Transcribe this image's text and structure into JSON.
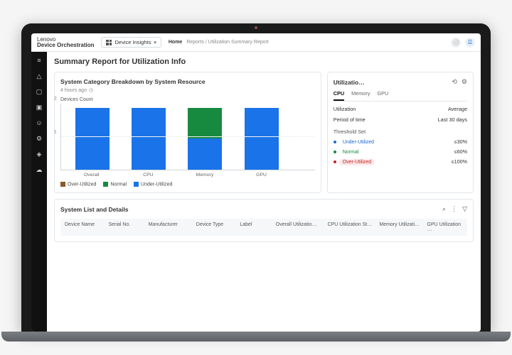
{
  "brand": {
    "line1": "Lenovo",
    "line2": "Device Orchestration"
  },
  "module_selector": {
    "label": "Device Insights"
  },
  "breadcrumbs": {
    "home": "Home",
    "path": "Reports / Utilization Summary Report"
  },
  "page_title": "Summary Report for Utilization Info",
  "chart_panel": {
    "title": "System Category Breakdown by System Resource",
    "timestamp": "4 hours ago",
    "y_axis_label": "Devices Count",
    "legend": {
      "over": "Over-Utilized",
      "normal": "Normal",
      "under": "Under-Utilized"
    }
  },
  "chart_data": {
    "type": "bar",
    "stacked": true,
    "categories": [
      "Overall",
      "CPU",
      "Memory",
      "GPU"
    ],
    "series": [
      {
        "name": "Over-Utilized",
        "color": "#8a5a2a",
        "values": [
          0,
          0,
          0,
          0
        ]
      },
      {
        "name": "Normal",
        "color": "#188a3f",
        "values": [
          0,
          0,
          1,
          0
        ]
      },
      {
        "name": "Under-Utilized",
        "color": "#1a73e8",
        "values": [
          2,
          2,
          1,
          2
        ]
      }
    ],
    "ylabel": "Devices Count",
    "ylim": [
      0,
      2
    ],
    "yticks": [
      1,
      2
    ]
  },
  "side_panel": {
    "title": "Utilizatio…",
    "tabs": [
      "CPU",
      "Memory",
      "GPU"
    ],
    "active_tab": "CPU",
    "rows": {
      "utilization_label": "Utilization",
      "utilization_value": "Average",
      "period_label": "Period of time",
      "period_value": "Last 30 days"
    },
    "threshold_title": "Threshold Set",
    "thresholds": [
      {
        "label": "Under-Utilized",
        "value": "≤30%",
        "kind": "under"
      },
      {
        "label": "Normal",
        "value": "≤60%",
        "kind": "normal"
      },
      {
        "label": "Over-Utilized",
        "value": "≤100%",
        "kind": "over"
      }
    ]
  },
  "list_panel": {
    "title": "System List and Details",
    "columns": [
      "Device Name",
      "Serial No.",
      "Manufacturer",
      "Device Type",
      "Label",
      "Overall Utilizatio…",
      "CPU Utilization St…",
      "Memory Utilizati…",
      "GPU Utilization …"
    ]
  },
  "sidebar_icons": [
    "menu",
    "alert",
    "monitor",
    "devices",
    "person",
    "gear",
    "shield",
    "cloud"
  ]
}
